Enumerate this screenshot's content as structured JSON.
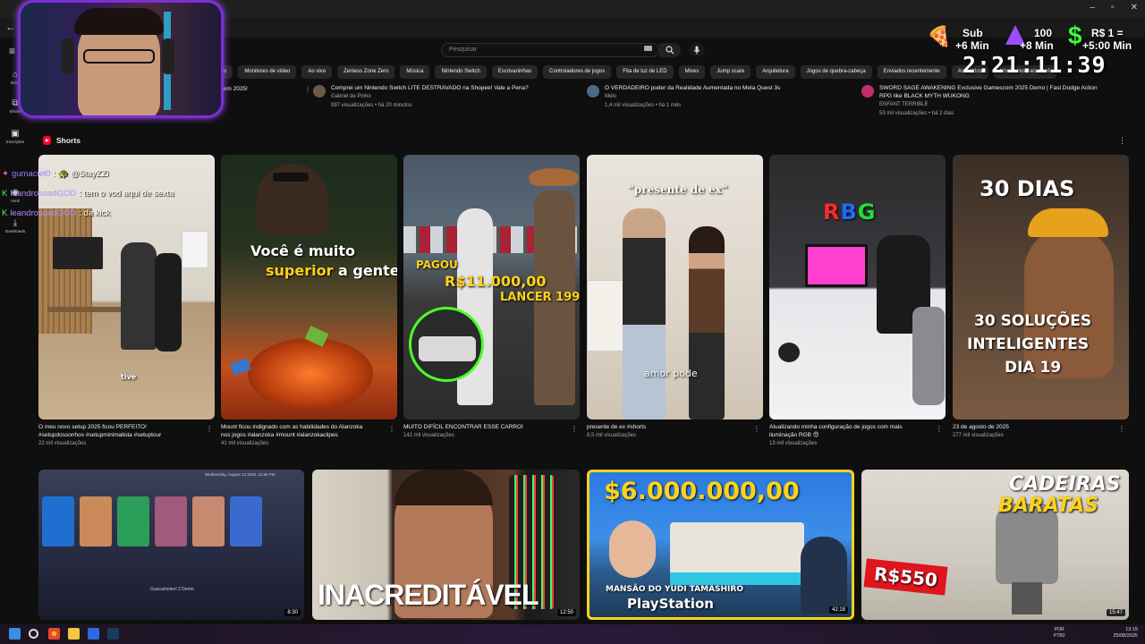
{
  "search": {
    "placeholder": "Pesquisar"
  },
  "sidebar": {
    "items": [
      {
        "label": "Início",
        "icon": "home-icon"
      },
      {
        "label": "Shorts",
        "icon": "shorts-icon"
      },
      {
        "label": "Inscrições",
        "icon": "subscriptions-icon"
      },
      {
        "label": "Você",
        "icon": "you-icon"
      },
      {
        "label": "Downloads",
        "icon": "download-icon"
      }
    ]
  },
  "chips": [
    "vo",
    "Monitores de vídeo",
    "Ao vivo",
    "Zenless Zone Zero",
    "Música",
    "Nintendo Switch",
    "Escrivaninhas",
    "Controladores de jogos",
    "Fita de luz de LED",
    "Mixes",
    "Jump scare",
    "Arquitetura",
    "Jogos de quebra-cabeça",
    "Enviados recentemente",
    "Assistidos",
    "Novidades para você"
  ],
  "top_row": {
    "partial_title": "rar em 2025!",
    "videos": [
      {
        "title": "Comprei um Nintendo Switch LITE DESTRAVADO na Shopee! Vale a Pena?",
        "channel": "Gabriel de Pinho",
        "stats": "997 visualizações • há 20 minutos"
      },
      {
        "title": "O VERDADEIRO poder da Realidade Aumentada no Meta Quest 3s",
        "channel": "Melo",
        "stats": "1,4 mil visualizações • há 1 mês"
      },
      {
        "title_line1": "SWORD SAGE AWAKENING Exclusive Gamescom 2025 Demo | Fast Dodge Action",
        "title_line2": "RPG like BLACK MYTH WUKONG",
        "channel": "ENFANT TERRIBLE",
        "stats": "53 mil visualizações • há 2 dias"
      }
    ]
  },
  "shorts": {
    "heading": "Shorts",
    "items": [
      {
        "title_line1": "O meu novo setup 2025 ficou PERFEITO!",
        "title_line2": "#setupdossonhos #setupminimalista #setuptour",
        "views": "22 mil visualizações",
        "overlay": "tive"
      },
      {
        "title_line1": "Mount ficou indignado com as habilidades do Alanzoka",
        "title_line2": "nos jogos #alanzoka #mount #alanzokaclipes",
        "views": "41 mil visualizações",
        "overlay_line1": "Você é muito",
        "overlay_line2a": "superior",
        "overlay_line2b": " a gente"
      },
      {
        "title_line1": "MUITO DIFÍCIL ENCONTRAR ESSE CARRO!",
        "title_line2": "",
        "views": "142 mil visualizações",
        "overlay_a": "PAGOU",
        "overlay_b": "R$11.000,00",
        "overlay_c": "LANCER 1995"
      },
      {
        "title_line1": "presente de ex #shorts",
        "title_line2": "",
        "views": "8,5 mil visualizações",
        "overlay_a": "“presente de ex”",
        "overlay_b": "amor pode"
      },
      {
        "title_line1": "Atualizando minha configuração de jogos com mais",
        "title_line2": "iluminação RGB 😍",
        "views": "13 mil visualizações",
        "overlay": "RBG"
      },
      {
        "title_line1": "23 de agosto de 2025",
        "title_line2": "",
        "views": "277 mil visualizações",
        "overlay_a": "30 DIAS",
        "overlay_b1": "30 SOLUÇÕES",
        "overlay_b2": "INTELIGENTES",
        "overlay_b3": "DIA 19"
      }
    ]
  },
  "bottom_row": [
    {
      "duration": "8:30",
      "overlay_top": "Wednesday, August 13 2025, 11:50 PM",
      "overlay_bottom": "Guacamelee! 2 Demo"
    },
    {
      "duration": "12:50",
      "overlay": "INACREDITÁVEL"
    },
    {
      "duration": "42:18",
      "overlay_a": "$6.000.000,00",
      "overlay_b": "MANSÃO DO YUDI TAMASHIRO",
      "overlay_c": "PlayStation"
    },
    {
      "duration": "15:47",
      "overlay_a": "CADEIRAS",
      "overlay_b": "BARATAS",
      "overlay_c": "R$550"
    }
  ],
  "chat": [
    {
      "user": "gumaciel0",
      "message": ": 🐢 @StayZZi"
    },
    {
      "user": "leandrosoadGOD",
      "message": ": tem o vod aqui de sexta"
    },
    {
      "user": "leandrosoadGOD",
      "message": ": da kick"
    }
  ],
  "timer": {
    "sub_label": "Sub",
    "sub_value": "+6 Min",
    "bits_label": "100",
    "bits_value": "+8 Min",
    "money_label": "R$ 1 =",
    "money_value": "+5:00 Min",
    "clock": "2:21:11:39"
  },
  "taskbar": {
    "lang1": "POR",
    "lang2": "PTB2",
    "time": "13:15",
    "date": "25/08/2025"
  },
  "colors": {
    "accent": "#ff0033",
    "webcam_border": "#7c2fd6",
    "chat_user": "#9b7bff"
  }
}
